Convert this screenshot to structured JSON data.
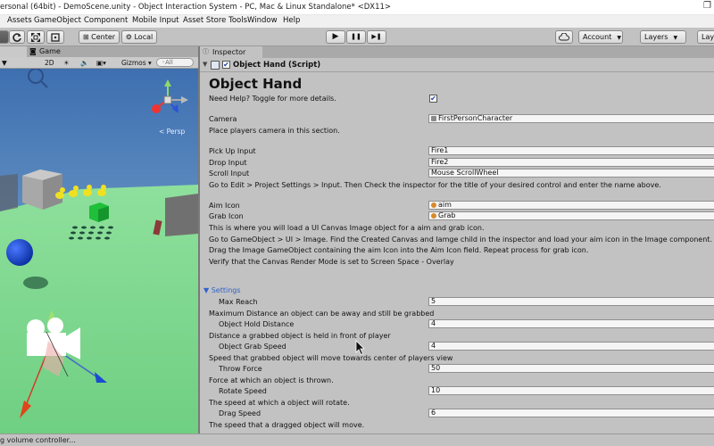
{
  "window": {
    "title": "ersonal (64bit) - DemoScene.unity - Object Interaction System - PC, Mac & Linux Standalone* <DX11>",
    "restore_glyph": "❐"
  },
  "menu": [
    "Assets",
    "GameObject",
    "Component",
    "Mobile Input",
    "Asset Store Tools",
    "Window",
    "Help"
  ],
  "toolbar": {
    "pivot_label": "Center",
    "space_label": "Local",
    "account_label": "Account",
    "layers_label": "Layers",
    "layout_label": "Lay",
    "play_glyph": "▶",
    "pause_glyph": "❚❚",
    "step_glyph": "▶❚"
  },
  "scene_tabs": {
    "game_tab": "Game"
  },
  "scene_toolbar": {
    "mode_2d": "2D",
    "gizmos": "Gizmos",
    "search_placeholder": "◦All"
  },
  "scene": {
    "persp_label": "< Persp"
  },
  "inspector": {
    "tab_label": "Inspector",
    "component_name": "Object Hand (Script)",
    "heading": "Object Hand",
    "help_label": "Need Help? Toggle for more details.",
    "help_checked": "✔",
    "camera_label": "Camera",
    "camera_value": "FirstPersonCharacter",
    "camera_help": "Place players camera in this section.",
    "pickup_label": "Pick Up Input",
    "pickup_value": "Fire1",
    "drop_label": "Drop Input",
    "drop_value": "Fire2",
    "scroll_label": "Scroll Input",
    "scroll_value": "Mouse ScrollWheel",
    "input_help": "Go to Edit > Project Settings > Input. Then Check the inspector for the title of your desired control and enter the name above.",
    "aim_label": "Aim Icon",
    "aim_value": "aim",
    "grab_label": "Grab Icon",
    "grab_value": "Grab",
    "icon_help_1": "This is where you will load a UI Canvas Image object for a aim and grab icon.",
    "icon_help_2": "Go to GameObject > UI > Image. Find the Created Canvas and Iamge child in the inspector and load your aim icon in the Image component.",
    "icon_help_3": "Drag the Image GameObject containing the aim Icon into the Aim Icon field. Repeat process for grab icon.",
    "icon_help_4": "Verify that the Canvas Render Mode is set to Screen Space - Overlay",
    "settings_label": "▼ Settings",
    "max_reach_label": "Max Reach",
    "max_reach_value": "5",
    "max_reach_help": "Maximum Distance an object can be away and still be grabbed",
    "hold_label": "Object Hold Distance",
    "hold_value": "4",
    "hold_help": "Distance a grabbed object is held in front of player",
    "grab_speed_label": "Object Grab Speed",
    "grab_speed_value": "4",
    "grab_speed_help": "Speed that grabbed object will move towards center of players view",
    "throw_label": "Throw Force",
    "throw_value": "50",
    "throw_help": "Force at which an object is thrown.",
    "rotate_label": "Rotate Speed",
    "rotate_value": "10",
    "rotate_help": "The speed at which a object will rotate.",
    "drag_label": "Drag Speed",
    "drag_value": "6",
    "drag_help": "The speed that a dragged object will move."
  },
  "status": {
    "text": "g volume controller..."
  },
  "colors": {
    "sky_top": "#3e6fb0",
    "sky_bottom": "#8fb9d8",
    "ground": "#7fd68f",
    "settings_blue": "#2f62c8",
    "object_icon": "#d88a2a"
  }
}
